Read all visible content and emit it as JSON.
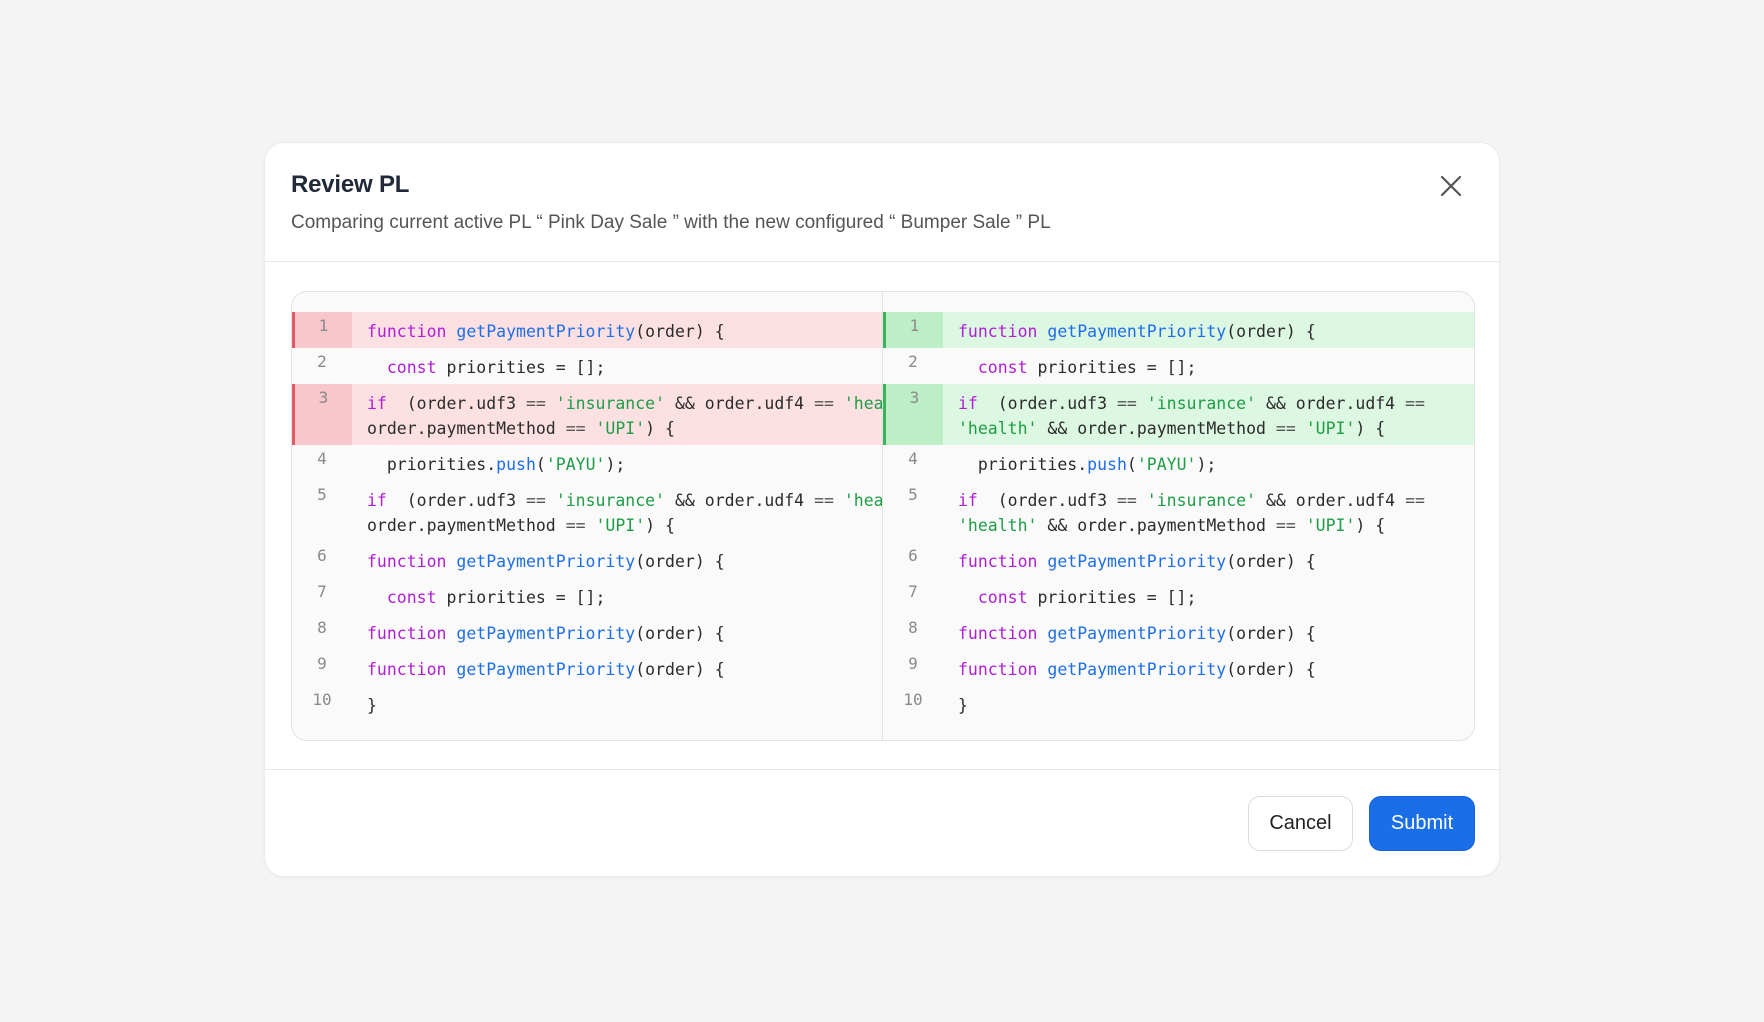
{
  "modal": {
    "title": "Review PL",
    "subtitle": "Comparing current active PL “ Pink Day Sale ” with the new configured “ Bumper Sale ” PL"
  },
  "diff": {
    "left": [
      {
        "num": "1",
        "status": "removed",
        "lines": [
          [
            [
              "kw",
              "function"
            ],
            [
              "",
              ""
            ],
            [
              "fn",
              "getPaymentPriority"
            ],
            [
              "",
              "(order) {"
            ]
          ]
        ]
      },
      {
        "num": "2",
        "status": "normal",
        "lines": [
          [
            [
              "",
              "  "
            ],
            [
              "kw",
              "const"
            ],
            [
              "",
              "priorities = [];"
            ]
          ]
        ]
      },
      {
        "num": "3",
        "status": "removed",
        "lines": [
          [
            [
              "kw",
              "if"
            ],
            [
              "",
              " (order.udf3 "
            ],
            [
              "op",
              "=="
            ],
            [
              "",
              " "
            ],
            [
              "str",
              "'insurance'"
            ],
            [
              "",
              " && order.udf4 "
            ],
            [
              "op",
              "=="
            ],
            [
              "",
              " "
            ],
            [
              "str",
              "'health'"
            ],
            [
              "",
              " &&"
            ]
          ],
          [
            [
              "",
              "order.paymentMethod "
            ],
            [
              "op",
              "=="
            ],
            [
              "",
              " "
            ],
            [
              "str",
              "'UPI'"
            ],
            [
              "",
              ") {"
            ]
          ]
        ]
      },
      {
        "num": "4",
        "status": "normal",
        "lines": [
          [
            [
              "",
              "  priorities."
            ],
            [
              "fn",
              "push"
            ],
            [
              "",
              "("
            ],
            [
              "str",
              "'PAYU'"
            ],
            [
              "",
              ");"
            ]
          ]
        ]
      },
      {
        "num": "5",
        "status": "normal",
        "lines": [
          [
            [
              "kw",
              "if"
            ],
            [
              "",
              " (order.udf3 "
            ],
            [
              "op",
              "=="
            ],
            [
              "",
              " "
            ],
            [
              "str",
              "'insurance'"
            ],
            [
              "",
              " && order.udf4 "
            ],
            [
              "op",
              "=="
            ],
            [
              "",
              " "
            ],
            [
              "str",
              "'health'"
            ],
            [
              "",
              " &&"
            ]
          ],
          [
            [
              "",
              "order.paymentMethod "
            ],
            [
              "op",
              "=="
            ],
            [
              "",
              " "
            ],
            [
              "str",
              "'UPI'"
            ],
            [
              "",
              ") {"
            ]
          ]
        ]
      },
      {
        "num": "6",
        "status": "normal",
        "lines": [
          [
            [
              "kw",
              "function"
            ],
            [
              "",
              ""
            ],
            [
              "fn",
              "getPaymentPriority"
            ],
            [
              "",
              "(order) {"
            ]
          ]
        ]
      },
      {
        "num": "7",
        "status": "normal",
        "lines": [
          [
            [
              "",
              "  "
            ],
            [
              "kw",
              "const"
            ],
            [
              "",
              "priorities = [];"
            ]
          ]
        ]
      },
      {
        "num": "8",
        "status": "normal",
        "lines": [
          [
            [
              "kw",
              "function"
            ],
            [
              "",
              ""
            ],
            [
              "fn",
              "getPaymentPriority"
            ],
            [
              "",
              "(order) {"
            ]
          ]
        ]
      },
      {
        "num": "9",
        "status": "normal",
        "lines": [
          [
            [
              "kw",
              "function"
            ],
            [
              "",
              ""
            ],
            [
              "fn",
              "getPaymentPriority"
            ],
            [
              "",
              "(order) {"
            ]
          ]
        ]
      },
      {
        "num": "10",
        "status": "normal",
        "lines": [
          [
            [
              "",
              "}"
            ]
          ]
        ]
      }
    ],
    "right": [
      {
        "num": "1",
        "status": "added",
        "lines": [
          [
            [
              "kw",
              "function"
            ],
            [
              "",
              ""
            ],
            [
              "fn",
              "getPaymentPriority"
            ],
            [
              "",
              "(order) {"
            ]
          ]
        ]
      },
      {
        "num": "2",
        "status": "normal",
        "lines": [
          [
            [
              "",
              "  "
            ],
            [
              "kw",
              "const"
            ],
            [
              "",
              "priorities = [];"
            ]
          ]
        ]
      },
      {
        "num": "3",
        "status": "added",
        "lines": [
          [
            [
              "kw",
              "if"
            ],
            [
              "",
              " (order.udf3 "
            ],
            [
              "op",
              "=="
            ],
            [
              "",
              " "
            ],
            [
              "str",
              "'insurance'"
            ],
            [
              "",
              " && order.udf4 "
            ],
            [
              "op",
              "=="
            ]
          ],
          [
            [
              "str",
              "'health'"
            ],
            [
              "",
              " && order.paymentMethod "
            ],
            [
              "op",
              "=="
            ],
            [
              "",
              " "
            ],
            [
              "str",
              "'UPI'"
            ],
            [
              "",
              ") {"
            ]
          ]
        ]
      },
      {
        "num": "4",
        "status": "normal",
        "lines": [
          [
            [
              "",
              "  priorities."
            ],
            [
              "fn",
              "push"
            ],
            [
              "",
              "("
            ],
            [
              "str",
              "'PAYU'"
            ],
            [
              "",
              ");"
            ]
          ]
        ]
      },
      {
        "num": "5",
        "status": "normal",
        "lines": [
          [
            [
              "kw",
              "if"
            ],
            [
              "",
              " (order.udf3 "
            ],
            [
              "op",
              "=="
            ],
            [
              "",
              " "
            ],
            [
              "str",
              "'insurance'"
            ],
            [
              "",
              " && order.udf4 "
            ],
            [
              "op",
              "=="
            ]
          ],
          [
            [
              "str",
              "'health'"
            ],
            [
              "",
              " && order.paymentMethod "
            ],
            [
              "op",
              "=="
            ],
            [
              "",
              " "
            ],
            [
              "str",
              "'UPI'"
            ],
            [
              "",
              ") {"
            ]
          ]
        ]
      },
      {
        "num": "6",
        "status": "normal",
        "lines": [
          [
            [
              "kw",
              "function"
            ],
            [
              "",
              ""
            ],
            [
              "fn",
              "getPaymentPriority"
            ],
            [
              "",
              "(order) {"
            ]
          ]
        ]
      },
      {
        "num": "7",
        "status": "normal",
        "lines": [
          [
            [
              "",
              "  "
            ],
            [
              "kw",
              "const"
            ],
            [
              "",
              "priorities = [];"
            ]
          ]
        ]
      },
      {
        "num": "8",
        "status": "normal",
        "lines": [
          [
            [
              "kw",
              "function"
            ],
            [
              "",
              ""
            ],
            [
              "fn",
              "getPaymentPriority"
            ],
            [
              "",
              "(order) {"
            ]
          ]
        ]
      },
      {
        "num": "9",
        "status": "normal",
        "lines": [
          [
            [
              "kw",
              "function"
            ],
            [
              "",
              ""
            ],
            [
              "fn",
              "getPaymentPriority"
            ],
            [
              "",
              "(order) {"
            ]
          ]
        ]
      },
      {
        "num": "10",
        "status": "normal",
        "lines": [
          [
            [
              "",
              "}"
            ]
          ]
        ]
      }
    ]
  },
  "footer": {
    "cancel_label": "Cancel",
    "submit_label": "Submit"
  },
  "colors": {
    "removed_bg": "#fde0e2",
    "removed_gutter": "#f7c7cb",
    "removed_border": "#e05a67",
    "added_bg": "#dcf7e2",
    "added_gutter": "#bdeec6",
    "added_border": "#3bb35a",
    "keyword": "#b01fd6",
    "function": "#1e6ee8",
    "string": "#1f9d46",
    "primary_button": "#1a6fe8"
  },
  "icons": {
    "close": "close-icon"
  }
}
